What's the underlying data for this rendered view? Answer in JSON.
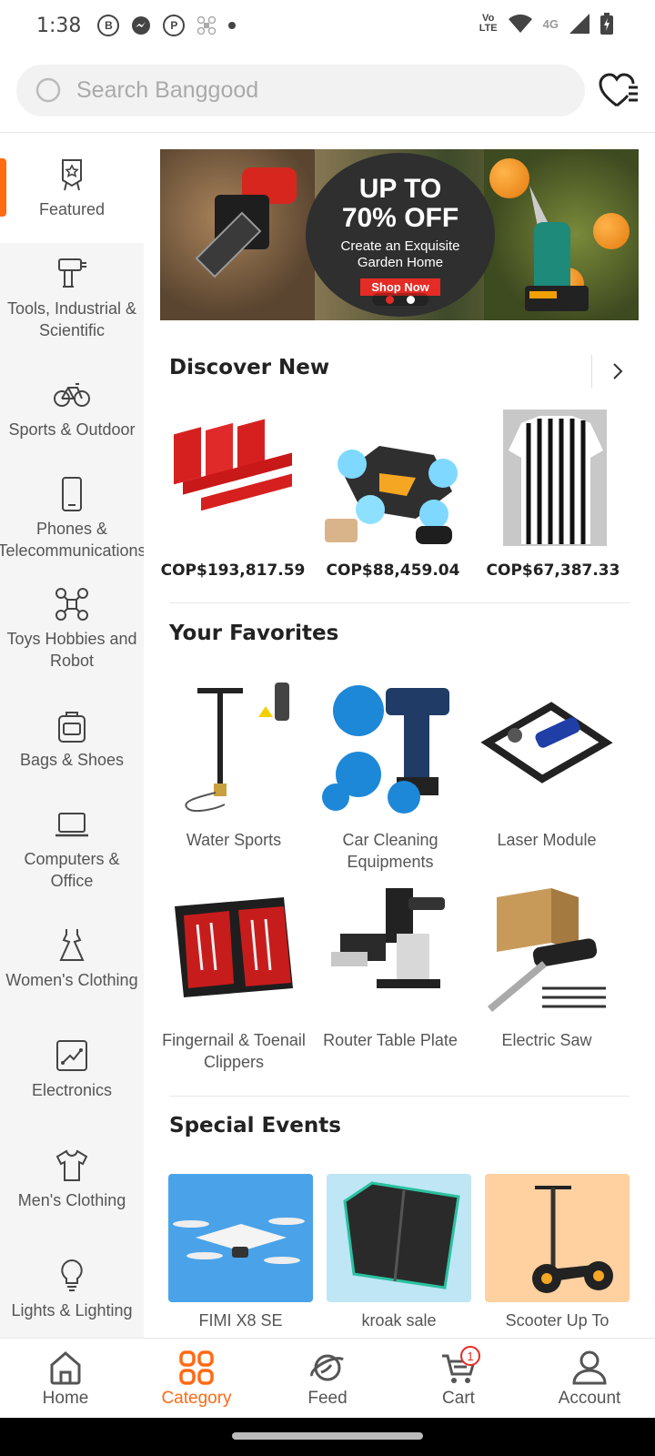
{
  "status": {
    "time": "1:38",
    "network_label": "4G",
    "volte_top": "Vo",
    "volte_bottom": "LTE"
  },
  "search": {
    "placeholder": "Search Banggood"
  },
  "sidebar": {
    "items": [
      {
        "label": "Featured",
        "icon": "featured-badge-icon"
      },
      {
        "label": "Tools, Industrial & Scientific",
        "icon": "drill-icon"
      },
      {
        "label": "Sports & Outdoor",
        "icon": "bicycle-icon"
      },
      {
        "label": "Phones & Telecommunications",
        "icon": "phone-icon"
      },
      {
        "label": "Toys Hobbies and Robot",
        "icon": "drone-icon"
      },
      {
        "label": "Bags & Shoes",
        "icon": "bag-icon"
      },
      {
        "label": "Computers & Office",
        "icon": "laptop-icon"
      },
      {
        "label": "Women's Clothing",
        "icon": "dress-icon"
      },
      {
        "label": "Electronics",
        "icon": "circuit-icon"
      },
      {
        "label": "Men's Clothing",
        "icon": "shirt-icon"
      },
      {
        "label": "Lights & Lighting",
        "icon": "bulb-icon"
      }
    ]
  },
  "banner": {
    "headline": "UP TO 70% OFF",
    "headline_line1": "UP TO",
    "headline_line2": "70% OFF",
    "sub_line1": "Create an Exquisite",
    "sub_line2": "Garden Home",
    "cta": "Shop Now"
  },
  "discover": {
    "title": "Discover New",
    "products": [
      {
        "price": "COP$193,817.59"
      },
      {
        "price": "COP$88,459.04"
      },
      {
        "price": "COP$67,387.33"
      }
    ]
  },
  "favorites": {
    "title": "Your Favorites",
    "items": [
      {
        "name": "Water Sports"
      },
      {
        "name": "Car Cleaning Equipments"
      },
      {
        "name": "Laser Module"
      },
      {
        "name": "Fingernail & Toenail Clippers"
      },
      {
        "name": "Router Table Plate"
      },
      {
        "name": "Electric Saw"
      }
    ]
  },
  "events": {
    "title": "Special Events",
    "items": [
      {
        "name": "FIMI X8 SE",
        "bg": "#4aa3e8"
      },
      {
        "name": "kroak sale",
        "bg": "#bfe6f5"
      },
      {
        "name": "Scooter Up To",
        "bg": "#ffd0a0"
      }
    ]
  },
  "nav": {
    "items": [
      {
        "label": "Home"
      },
      {
        "label": "Category"
      },
      {
        "label": "Feed"
      },
      {
        "label": "Cart"
      },
      {
        "label": "Account"
      }
    ],
    "cart_badge": "1"
  },
  "colors": {
    "accent": "#ff6a13",
    "sale_red": "#e52b25",
    "sidebar_bg": "#f5f5f5"
  }
}
